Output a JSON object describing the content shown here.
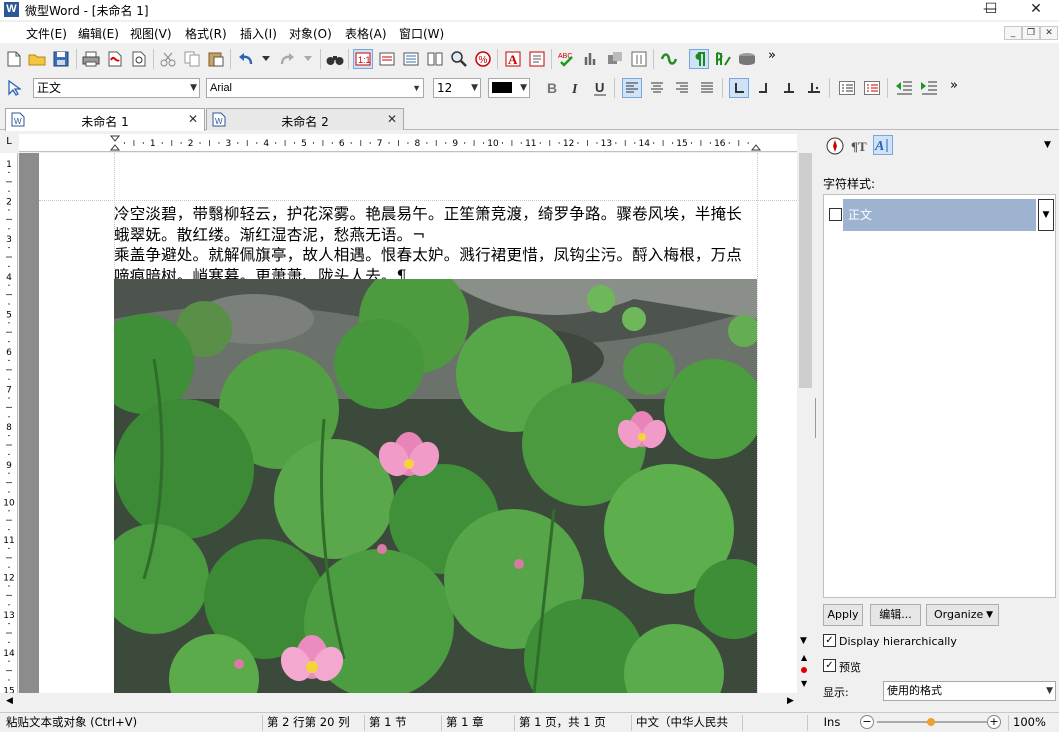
{
  "window": {
    "title": "微型Word - [未命名 1]",
    "app_icon_letter": "W",
    "minimize_glyph": "—",
    "maximize_glyph": "☐",
    "close_glyph": "✕"
  },
  "menu": {
    "items": [
      "文件(E)",
      "编辑(E)",
      "视图(V)",
      "格式(R)",
      "插入(I)",
      "对象(O)",
      "表格(A)",
      "窗口(W)"
    ]
  },
  "format_bar": {
    "style_value": "正文",
    "font_value": "Arial",
    "size_value": "12",
    "more_glyph": "»"
  },
  "tabs": [
    {
      "label": "未命名 1",
      "close": "✕"
    },
    {
      "label": "未命名 2",
      "close": "✕"
    }
  ],
  "ruler": {
    "corner_glyph": "L",
    "h_numbers": [
      "1",
      "2",
      "3",
      "4",
      "5",
      "6",
      "7",
      "8",
      "9",
      "10",
      "11",
      "12",
      "13",
      "14",
      "15",
      "16"
    ],
    "v_numbers": [
      "1",
      "2",
      "3",
      "4",
      "5",
      "6",
      "7",
      "8",
      "9",
      "10",
      "11",
      "12",
      "13",
      "14",
      "15"
    ]
  },
  "document": {
    "line1": "冷空淡碧，带翳柳轻云，护花深雾。艳晨易午。正笙箫竞渡，绮罗争路。骤卷风埃，半掩长",
    "line2": "蛾翠妩。散红缕。渐红湿杏泥，愁燕无语。¬",
    "line3": "乘盖争避处。就解佩旗亭，故人相遇。恨春太妒。溅行裙更惜，凤钩尘污。酹入梅根，万点",
    "line4": "啼痕暗树。峭寒暮。更萧萧、陇头人去。¶"
  },
  "side_panel": {
    "char_style_label": "字符样式:",
    "list_item": "正文",
    "apply_button": "Apply",
    "edit_button": "编辑...",
    "organize_button": "Organize",
    "display_hier_label": "Display hierarchically",
    "preview_label": "预览",
    "show_label": "显示:",
    "show_value": "使用的格式",
    "display_hier_checked": true,
    "preview_checked": true
  },
  "statusbar": {
    "hint": "粘贴文本或对象 (Ctrl+V)",
    "position": "第 2 行第 20 列",
    "section": "第 1 节",
    "chapter": "第 1 章",
    "page": "第 1 页，共 1 页",
    "language": "中文（中华人民共",
    "ins": "Ins",
    "zoom": "100%",
    "zoom_minus": "−",
    "zoom_plus": "+"
  },
  "colors": {
    "list_highlight": "#9db3d0",
    "toolbar_pressed": "#cfe3f8",
    "font_color_swatch": "#000000"
  }
}
